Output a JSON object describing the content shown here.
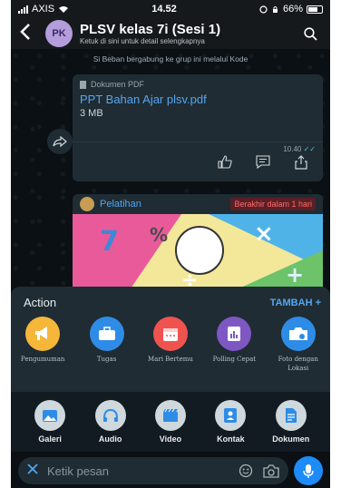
{
  "status_bar": {
    "carrier": "AXIS",
    "time": "14.52",
    "battery": "66%"
  },
  "header": {
    "avatar_initials": "PK",
    "title": "PLSV kelas 7i (Sesi 1)",
    "subtitle": "Ketuk di sini untuk detail selengkapnya"
  },
  "chat": {
    "system_message": "Si Beban bergabung ke grup ini melalui Kode",
    "document": {
      "type_label": "Dokumen PDF",
      "file_name": "PPT Bahan Ajar plsv.pdf",
      "size": "3 MB",
      "time": "10.40"
    },
    "poll": {
      "name": "Pelatihan",
      "badge": "Berakhir dalam 1 hari"
    }
  },
  "action_panel": {
    "title": "Action",
    "add_label": "TAMBAH +",
    "items": [
      {
        "label": "Pengumuman",
        "color": "#f5b63a",
        "icon": "megaphone-icon"
      },
      {
        "label": "Tugas",
        "color": "#2f8ce6",
        "icon": "briefcase-icon"
      },
      {
        "label": "Mari Bertemu",
        "color": "#ef5350",
        "icon": "calendar-icon"
      },
      {
        "label": "Polling Cepat",
        "color": "#7e57c2",
        "icon": "poll-icon"
      },
      {
        "label": "Foto dengan Lokasi",
        "color": "#2f8ce6",
        "icon": "camera-location-icon"
      }
    ]
  },
  "media_panel": {
    "items": [
      {
        "label": "Galeri",
        "icon": "gallery-icon"
      },
      {
        "label": "Audio",
        "icon": "headphones-icon"
      },
      {
        "label": "Video",
        "icon": "video-icon"
      },
      {
        "label": "Kontak",
        "icon": "contact-icon"
      },
      {
        "label": "Dokumen",
        "icon": "document-icon"
      }
    ]
  },
  "composer": {
    "placeholder": "Ketik pesan"
  }
}
